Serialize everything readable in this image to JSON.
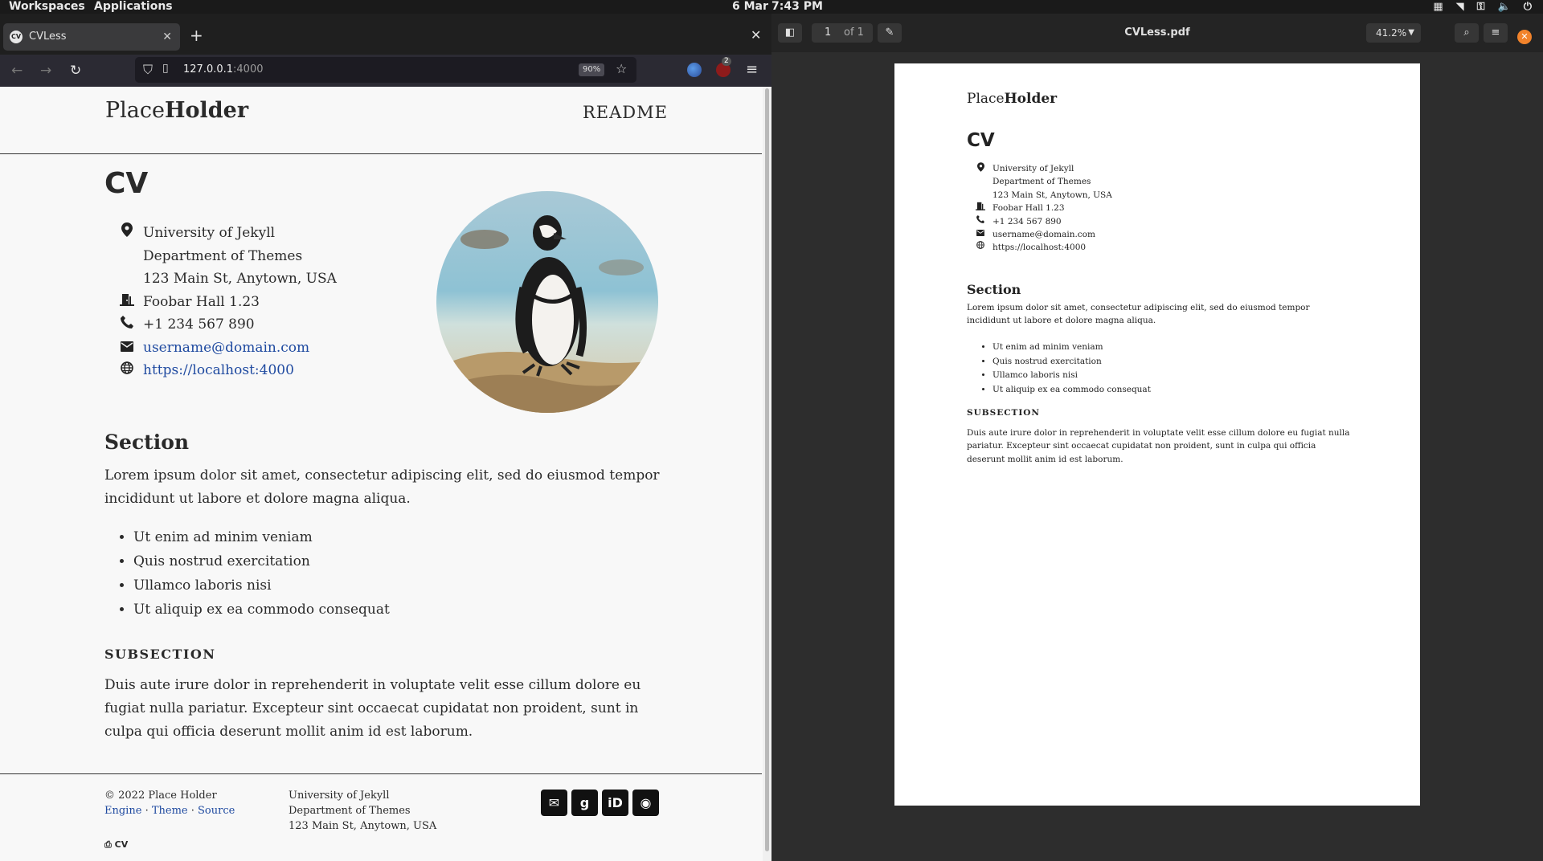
{
  "topbar": {
    "workspaces": "Workspaces",
    "applications": "Applications",
    "date": "6 Mar",
    "time": "7:43 PM"
  },
  "browser": {
    "tab_title": "CVLess",
    "favicon_text": "CV",
    "url_host": "127.0.0.1",
    "url_port": ":4000",
    "zoom": "90%",
    "ext_badge": "2"
  },
  "site": {
    "brand_light": "Place",
    "brand_bold": "Holder",
    "nav_readme": "README",
    "title": "CV",
    "contacts": {
      "line1": "University of Jekyll",
      "line2": "Department of Themes",
      "line3": "123 Main St, Anytown, USA",
      "room": "Foobar Hall 1.23",
      "phone": "+1 234 567 890",
      "email": "username@domain.com",
      "web": "https://localhost:4000"
    },
    "section_title": "Section",
    "section_text": "Lorem ipsum dolor sit amet, consectetur adipiscing elit, sed do eiusmod tempor incididunt ut labore et dolore magna aliqua.",
    "bullets": [
      "Ut enim ad minim veniam",
      "Quis nostrud exercitation",
      "Ullamco laboris nisi",
      "Ut aliquip ex ea commodo consequat"
    ],
    "subsection_title": "SUBSECTION",
    "subsection_text": "Duis aute irure dolor in reprehenderit in voluptate velit esse cillum dolore eu fugiat nulla pariatur. Excepteur sint occaecat cupidatat non proident, sunt in culpa qui officia deserunt mollit anim id est laborum.",
    "footer": {
      "copyright": "© 2022 Place Holder",
      "engine": "Engine",
      "theme": "Theme",
      "source": "Source",
      "sep": "·",
      "addr1": "University of Jekyll",
      "addr2": "Department of Themes",
      "addr3": "123 Main St, Anytown, USA",
      "print_label": "CV"
    }
  },
  "viewer": {
    "page_number": "1",
    "page_total": "of 1",
    "title": "CVLess.pdf",
    "zoom": "41.2%"
  },
  "icons": {
    "map_marker": "map-marker-icon",
    "door": "door-icon",
    "phone": "phone-icon",
    "envelope": "envelope-icon",
    "globe": "globe-icon",
    "print": "print-icon",
    "github": "github-icon",
    "orcid": "orcid-icon",
    "google_scholar": "google-scholar-icon"
  },
  "colors": {
    "link": "#1f4aa0",
    "viewer_close": "#f2832b"
  }
}
